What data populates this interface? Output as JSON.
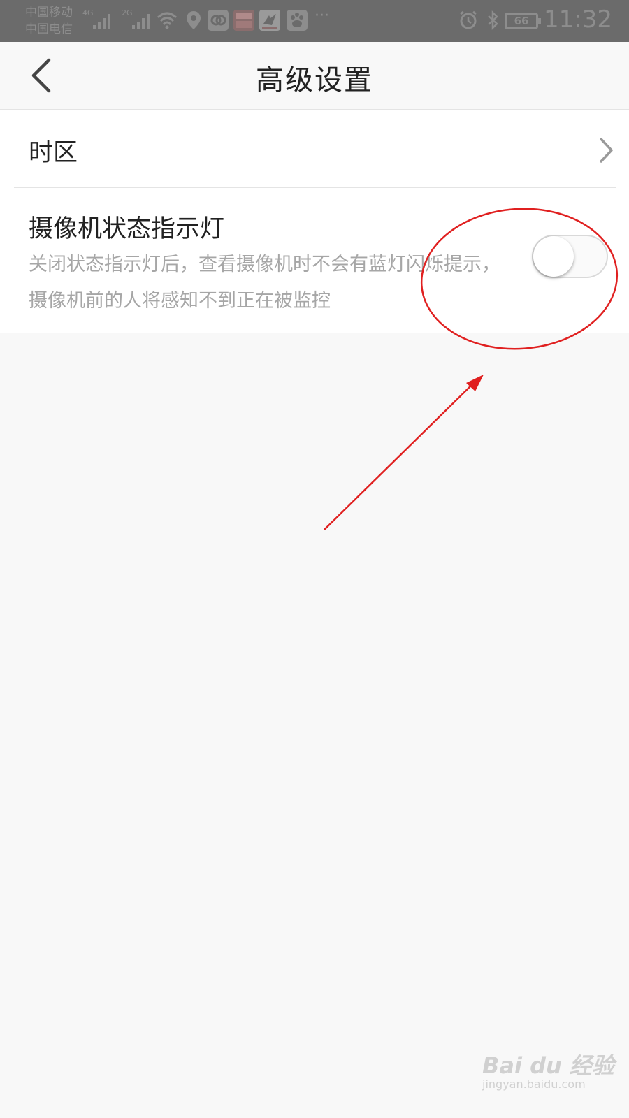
{
  "status_bar": {
    "carrier_1": "中国移动",
    "carrier_2": "中国电信",
    "network_1": "4G",
    "network_2": "2G",
    "app_icons": [
      "link-app-icon",
      "news-app-icon",
      "video-app-icon",
      "baidu-app-icon"
    ],
    "more": "···",
    "battery": "66",
    "time": "11:32"
  },
  "header": {
    "title": "高级设置"
  },
  "settings": {
    "timezone_label": "时区",
    "indicator_title": "摄像机状态指示灯",
    "indicator_description": "关闭状态指示灯后，查看摄像机时不会有蓝灯闪烁提示，摄像机前的人将感知不到正在被监控",
    "indicator_enabled": false
  },
  "watermark": {
    "logo": "Bai du 经验",
    "site": "jingyan.baidu.com"
  },
  "colors": {
    "annotation": "#e02020",
    "background": "#f8f8f8",
    "card": "#ffffff"
  }
}
